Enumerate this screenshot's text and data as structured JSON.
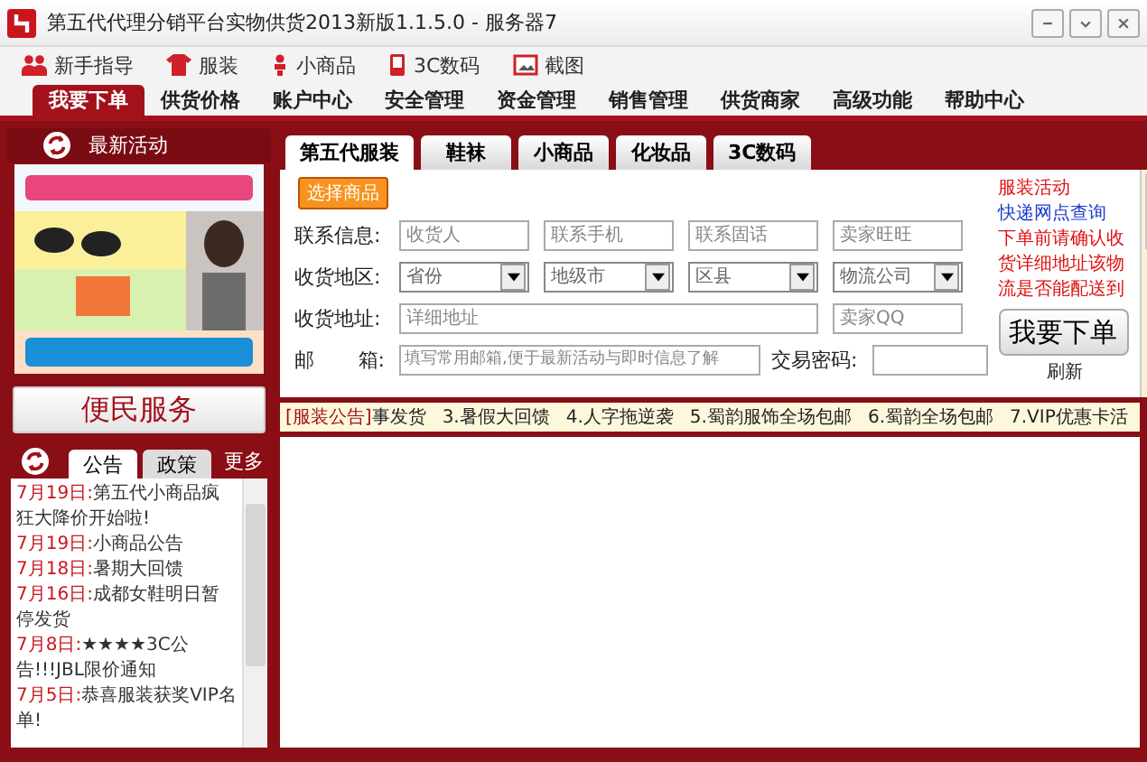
{
  "window": {
    "title": "第五代代理分销平台实物供货2013新版1.1.5.0 - 服务器7"
  },
  "toolbar": [
    {
      "label": "新手指导",
      "kind": "people"
    },
    {
      "label": "服装",
      "kind": "shirt"
    },
    {
      "label": "小商品",
      "kind": "figure"
    },
    {
      "label": "3C数码",
      "kind": "phone"
    },
    {
      "label": "截图",
      "kind": "screenshot"
    }
  ],
  "nav": [
    {
      "label": "我要下单",
      "selected": true
    },
    {
      "label": "供货价格",
      "selected": false
    },
    {
      "label": "账户中心",
      "selected": false
    },
    {
      "label": "安全管理",
      "selected": false
    },
    {
      "label": "资金管理",
      "selected": false
    },
    {
      "label": "销售管理",
      "selected": false
    },
    {
      "label": "供货商家",
      "selected": false
    },
    {
      "label": "高级功能",
      "selected": false
    },
    {
      "label": "帮助中心",
      "selected": false
    }
  ],
  "sidebar": {
    "activity_title": "最新活动",
    "service_button": "便民服务",
    "notice_tabs": [
      {
        "label": "公告",
        "selected": true
      },
      {
        "label": "政策",
        "selected": false
      }
    ],
    "more": "更多",
    "notices": [
      {
        "date": "7月19日:",
        "text": "第五代小商品疯狂大降价开始啦!"
      },
      {
        "date": "7月19日:",
        "text": "小商品公告"
      },
      {
        "date": "7月18日:",
        "text": "暑期大回馈"
      },
      {
        "date": "7月16日:",
        "text": "成都女鞋明日暂停发货"
      },
      {
        "date": "7月8日:",
        "text": "★★★★3C公告!!!JBL限价通知"
      },
      {
        "date": "7月5日:",
        "text": "恭喜服装获奖VIP名单!"
      }
    ]
  },
  "category_tabs": [
    {
      "label": "第五代服装",
      "selected": true
    },
    {
      "label": "鞋袜",
      "selected": false
    },
    {
      "label": "小商品",
      "selected": false
    },
    {
      "label": "化妆品",
      "selected": false
    },
    {
      "label": "3C数码",
      "selected": false
    }
  ],
  "form": {
    "select_button": "选择商品",
    "contact_label": "联系信息:",
    "contact_fields": [
      {
        "placeholder": "收货人"
      },
      {
        "placeholder": "联系手机"
      },
      {
        "placeholder": "联系固话"
      },
      {
        "placeholder": "卖家旺旺"
      }
    ],
    "region_label": "收货地区:",
    "region_selects": [
      {
        "value": "省份"
      },
      {
        "value": "地级市"
      },
      {
        "value": "区县"
      },
      {
        "value": "物流公司"
      }
    ],
    "address_label": "收货地址:",
    "address_placeholder": "详细地址",
    "qq_placeholder": "卖家QQ",
    "email_label_1": "邮",
    "email_label_2": "箱:",
    "email_placeholder": "填写常用邮箱,便于最新活动与即时信息了解",
    "password_label": "交易密码:",
    "submit_button": "我要下单",
    "refresh_link": "刷新"
  },
  "side_notes": [
    {
      "text": "服装活动",
      "kind": "alert"
    },
    {
      "text": "快递网点查询",
      "kind": "link"
    },
    {
      "text": "下单前请确认收货详细地址该物流是否能配送到",
      "kind": "alert"
    }
  ],
  "ticker": {
    "tag": "[服装公告]",
    "items": [
      "事发货",
      "3.暑假大回馈",
      "4.人字拖逆袭",
      "5.蜀韵服饰全场包邮",
      "6.蜀韵全场包邮",
      "7.VIP优惠卡活"
    ]
  }
}
